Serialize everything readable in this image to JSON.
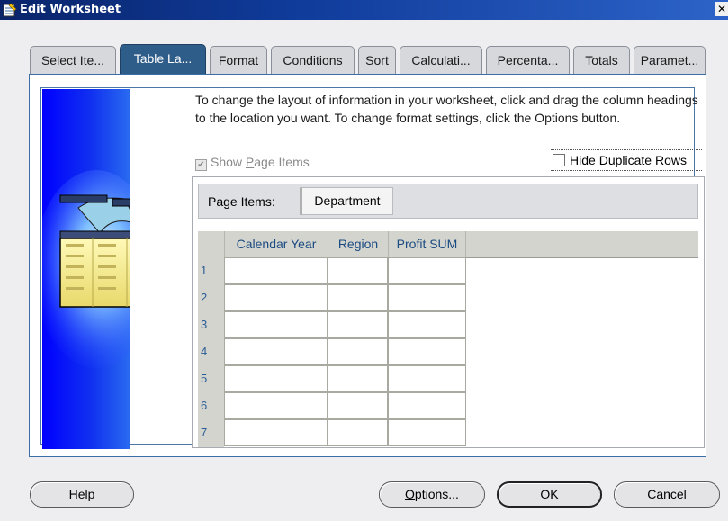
{
  "window": {
    "title": "Edit Worksheet",
    "close_glyph": "✕",
    "icon": "worksheet-icon"
  },
  "tabs": [
    {
      "label": "Select Ite...",
      "active": false
    },
    {
      "label": "Table La...",
      "active": true
    },
    {
      "label": "Format",
      "active": false
    },
    {
      "label": "Conditions",
      "active": false
    },
    {
      "label": "Sort",
      "active": false
    },
    {
      "label": "Calculati...",
      "active": false
    },
    {
      "label": "Percenta...",
      "active": false
    },
    {
      "label": "Totals",
      "active": false
    },
    {
      "label": "Paramet...",
      "active": false
    }
  ],
  "instructions": "To change the layout of information in your worksheet, click and drag the column headings to the location you want.  To change format settings, click the Options button.",
  "show_page_items": {
    "label_pre": "Show ",
    "label_underline": "P",
    "label_post": "age Items",
    "checked": true,
    "enabled": false
  },
  "hide_duplicate_rows": {
    "label_pre": "Hide ",
    "label_underline": "D",
    "label_post": "uplicate Rows",
    "checked": false
  },
  "page_items": {
    "label": "Page Items:",
    "items": [
      "Department"
    ]
  },
  "grid": {
    "columns": [
      "Calendar Year",
      "Region",
      "Profit SUM"
    ],
    "rows": [
      "1",
      "2",
      "3",
      "4",
      "5",
      "6",
      "7"
    ]
  },
  "buttons": {
    "help": "Help",
    "options_underline": "O",
    "options_rest": "ptions...",
    "ok": "OK",
    "cancel": "Cancel"
  },
  "colors": {
    "title_bar": "#0a246a",
    "active_tab": "#2f5d8a",
    "panel_border": "#3a6ea5"
  }
}
